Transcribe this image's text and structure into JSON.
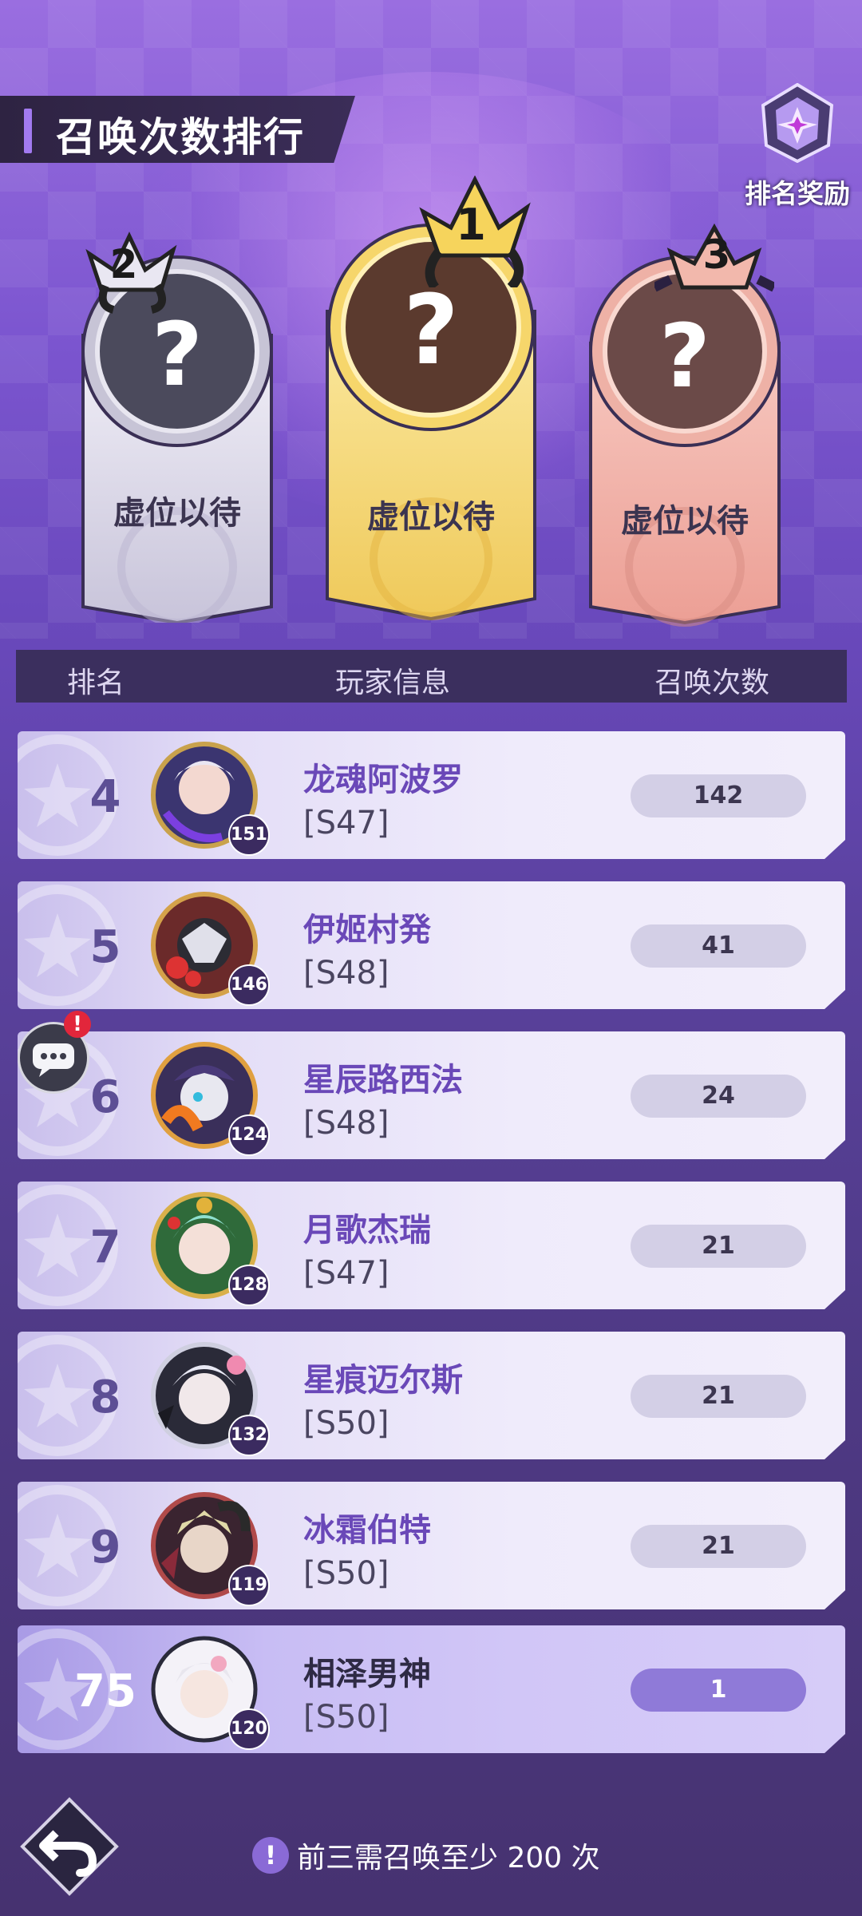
{
  "header": {
    "title": "召唤次数排行",
    "reward_label": "排名奖励"
  },
  "podium": [
    {
      "rank": "2",
      "label": "虚位以待",
      "mark": "?"
    },
    {
      "rank": "1",
      "label": "虚位以待",
      "mark": "?"
    },
    {
      "rank": "3",
      "label": "虚位以待",
      "mark": "?"
    }
  ],
  "table": {
    "columns": [
      "排名",
      "玩家信息",
      "召唤次数"
    ]
  },
  "rows": [
    {
      "rank": "4",
      "name": "龙魂阿波罗",
      "server": "[S47]",
      "level": "151",
      "count": "142"
    },
    {
      "rank": "5",
      "name": "伊姬村発",
      "server": "[S48]",
      "level": "146",
      "count": "41"
    },
    {
      "rank": "6",
      "name": "星辰路西法",
      "server": "[S48]",
      "level": "124",
      "count": "24"
    },
    {
      "rank": "7",
      "name": "月歌杰瑞",
      "server": "[S47]",
      "level": "128",
      "count": "21"
    },
    {
      "rank": "8",
      "name": "星痕迈尔斯",
      "server": "[S50]",
      "level": "132",
      "count": "21"
    },
    {
      "rank": "9",
      "name": "冰霜伯特",
      "server": "[S50]",
      "level": "119",
      "count": "21"
    }
  ],
  "self_row": {
    "rank": "75",
    "name": "相泽男神",
    "server": "[S50]",
    "level": "120",
    "count": "1"
  },
  "chat": {
    "alert": "!"
  },
  "footer": {
    "icon": "!",
    "text": "前三需召唤至少 200 次"
  },
  "colors": {
    "accent": "#a27af0",
    "name_purple": "#6a48b8",
    "gold": "#f3d56a",
    "silver": "#d9d6e6",
    "bronze": "#f0b0a8"
  }
}
